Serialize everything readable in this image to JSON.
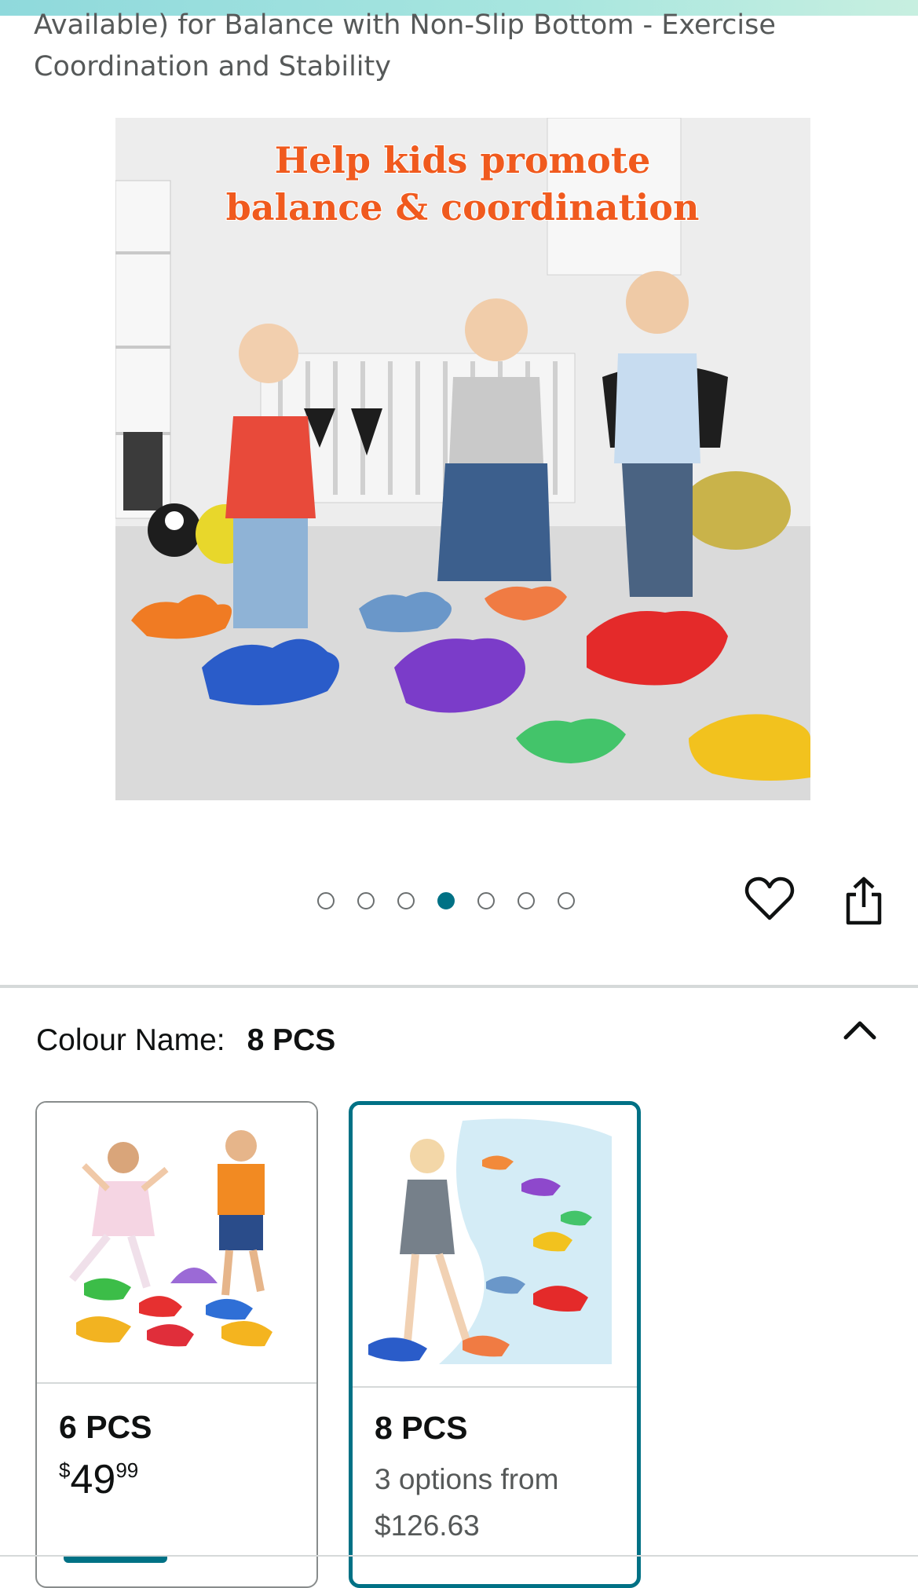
{
  "product": {
    "title": "Available) for Balance with Non-Slip Bottom - Exercise\nCoordination and Stability"
  },
  "gallery": {
    "image_headline_line1": "Help kids promote",
    "image_headline_line2": "balance & coordination",
    "total_images": 7,
    "active_index": 3,
    "wishlist_icon": "heart-icon",
    "share_icon": "share-icon"
  },
  "variation": {
    "label": "Colour Name:",
    "selected_value": "8 PCS",
    "collapse_icon": "chevron-up-icon",
    "options": [
      {
        "name": "6 PCS",
        "price_symbol": "$",
        "price_whole": "49",
        "price_fraction": "99"
      },
      {
        "name": "8 PCS",
        "options_text": "3 options from",
        "options_price": "$126.63"
      }
    ]
  },
  "colors": {
    "accent": "#007185",
    "divider": "#d5d9d9",
    "text": "#0f1111",
    "secondary_text": "#565959"
  }
}
